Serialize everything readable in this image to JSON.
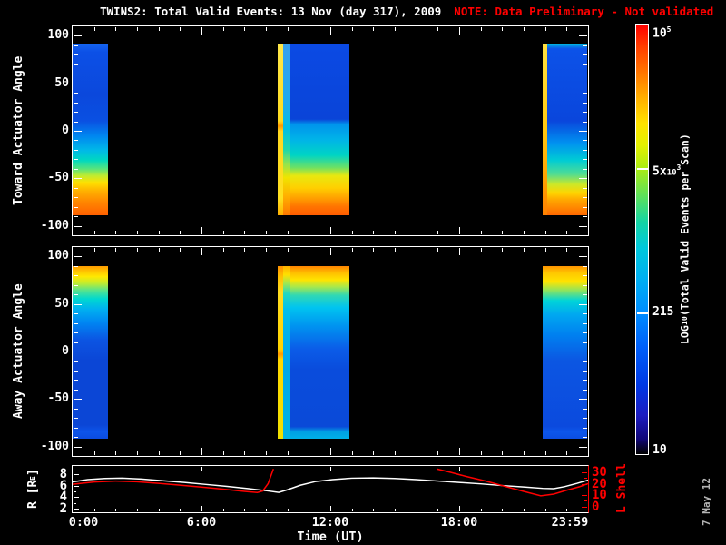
{
  "title": {
    "main": "TWINS2: Total Valid Events: 13 Nov (day 317), 2009",
    "note": "NOTE: Data Preliminary - Not validated"
  },
  "datestamp": "7 May 12",
  "colors": {
    "background": "#000000",
    "axis": "#ffffff",
    "warning_text": "#ff0000",
    "l_shell_axis": "#ff0000",
    "r_line": "#ffffff",
    "datestamp_text": "#b4b4b4"
  },
  "colorbar": {
    "label_parts": {
      "pre": "LOG",
      "sub": "10",
      "post": "(Total Valid Events per Scan)"
    },
    "ticks": [
      {
        "pre": "10",
        "sup": "5",
        "frac": 0.012,
        "dash": false
      },
      {
        "pre": "5x",
        "small": "10",
        "sup": "3",
        "frac": 0.334,
        "dash": true
      },
      {
        "pre": "215",
        "frac": 0.672,
        "dash": true
      },
      {
        "pre": "10",
        "frac": 0.994,
        "dash": false
      }
    ],
    "gradient": [
      [
        0,
        "#ff0000"
      ],
      [
        0.05,
        "#ff3c00"
      ],
      [
        0.11,
        "#ff7400"
      ],
      [
        0.17,
        "#ffae00"
      ],
      [
        0.23,
        "#ffe200"
      ],
      [
        0.28,
        "#e4f000"
      ],
      [
        0.335,
        "#aaec14"
      ],
      [
        0.4,
        "#5ce05c"
      ],
      [
        0.46,
        "#14d4a4"
      ],
      [
        0.52,
        "#00c8dc"
      ],
      [
        0.6,
        "#00acf4"
      ],
      [
        0.672,
        "#008cff"
      ],
      [
        0.75,
        "#0060fa"
      ],
      [
        0.84,
        "#0038e4"
      ],
      [
        0.91,
        "#1c1cc0"
      ],
      [
        0.965,
        "#100678"
      ],
      [
        0.988,
        "#060324"
      ],
      [
        1,
        "#000000"
      ]
    ]
  },
  "chart_data": [
    {
      "type": "heatmap",
      "id": "toward",
      "ylabel": "Toward Actuator Angle",
      "ylim": [
        -100,
        100
      ],
      "yticks": [
        100,
        50,
        0,
        -50,
        -100
      ],
      "xlim_hours": [
        0,
        24
      ],
      "blocks": [
        {
          "t0": 0.0,
          "t1": 1.65,
          "a0": 92,
          "a1": -89,
          "stops": [
            [
              0,
              "#1464f0"
            ],
            [
              0.05,
              "#0c50e6"
            ],
            [
              0.3,
              "#0b48dc"
            ],
            [
              0.45,
              "#0a50e2"
            ],
            [
              0.54,
              "#0088f0"
            ],
            [
              0.62,
              "#00b8e8"
            ],
            [
              0.68,
              "#00d8c0"
            ],
            [
              0.73,
              "#58e47c"
            ],
            [
              0.77,
              "#c0ec30"
            ],
            [
              0.81,
              "#ffe000"
            ],
            [
              0.86,
              "#ffb000"
            ],
            [
              0.92,
              "#ff8800"
            ],
            [
              1,
              "#ff6000"
            ]
          ]
        },
        {
          "t0": 9.55,
          "t1": 9.82,
          "a0": 92,
          "a1": -89,
          "stops": [
            [
              0,
              "#ffe84a"
            ],
            [
              0.45,
              "#ffdc20"
            ],
            [
              0.48,
              "#ff9800"
            ],
            [
              0.51,
              "#ffd820"
            ],
            [
              0.9,
              "#ffe020"
            ],
            [
              1,
              "#ffb000"
            ]
          ]
        },
        {
          "t0": 9.82,
          "t1": 10.12,
          "a0": 92,
          "a1": -89,
          "stops": [
            [
              0,
              "#38a0ee"
            ],
            [
              0.35,
              "#20aaee"
            ],
            [
              0.5,
              "#00c0e0"
            ],
            [
              0.62,
              "#20d8a8"
            ],
            [
              0.7,
              "#90e450"
            ],
            [
              0.78,
              "#f0e400"
            ],
            [
              0.88,
              "#ffb400"
            ],
            [
              1,
              "#ff7800"
            ]
          ]
        },
        {
          "t0": 10.12,
          "t1": 12.9,
          "a0": 92,
          "a1": -89,
          "stops": [
            [
              0,
              "#0b4ae4"
            ],
            [
              0.44,
              "#0a44d8"
            ],
            [
              0.47,
              "#0094ec"
            ],
            [
              0.56,
              "#00b4e8"
            ],
            [
              0.65,
              "#00d4c4"
            ],
            [
              0.72,
              "#68e068"
            ],
            [
              0.77,
              "#e8e810"
            ],
            [
              0.84,
              "#ffd000"
            ],
            [
              0.9,
              "#ffa000"
            ],
            [
              0.95,
              "#ff7400"
            ],
            [
              1,
              "#ff5c00"
            ]
          ]
        },
        {
          "t0": 21.9,
          "t1": 22.08,
          "a0": 92,
          "a1": -89,
          "stops": [
            [
              0,
              "#ffe040"
            ],
            [
              0.5,
              "#ffc810"
            ],
            [
              0.8,
              "#ffa000"
            ],
            [
              1,
              "#ff8000"
            ]
          ]
        },
        {
          "t0": 22.08,
          "t1": 23.96,
          "a0": 92,
          "a1": -89,
          "stops": [
            [
              0,
              "#00b4e0"
            ],
            [
              0.03,
              "#0c52e8"
            ],
            [
              0.45,
              "#0a46dc"
            ],
            [
              0.58,
              "#0092f0"
            ],
            [
              0.68,
              "#00ccd4"
            ],
            [
              0.76,
              "#50dc94"
            ],
            [
              0.82,
              "#cce828"
            ],
            [
              0.87,
              "#ffd400"
            ],
            [
              0.91,
              "#ffa800"
            ],
            [
              1,
              "#ff6800"
            ]
          ]
        }
      ]
    },
    {
      "type": "heatmap",
      "id": "away",
      "ylabel": "Away Actuator Angle",
      "ylim": [
        -100,
        100
      ],
      "yticks": [
        100,
        50,
        0,
        -50,
        -100
      ],
      "xlim_hours": [
        0,
        24
      ],
      "blocks": [
        {
          "t0": 0.0,
          "t1": 1.65,
          "a0": 90,
          "a1": -92,
          "stops": [
            [
              0,
              "#ff9c00"
            ],
            [
              0.03,
              "#ffc400"
            ],
            [
              0.06,
              "#ffe800"
            ],
            [
              0.1,
              "#c0ec30"
            ],
            [
              0.14,
              "#58e48c"
            ],
            [
              0.19,
              "#00d8d0"
            ],
            [
              0.25,
              "#00b0f0"
            ],
            [
              0.33,
              "#0084f2"
            ],
            [
              0.43,
              "#0c54e2"
            ],
            [
              0.55,
              "#0b46d6"
            ],
            [
              0.92,
              "#0b46d6"
            ],
            [
              0.96,
              "#0d54ea"
            ],
            [
              1,
              "#0b4ce0"
            ]
          ]
        },
        {
          "t0": 9.55,
          "t1": 9.82,
          "a0": 90,
          "a1": -92,
          "stops": [
            [
              0,
              "#ff9000"
            ],
            [
              0.06,
              "#ffc000"
            ],
            [
              0.15,
              "#ffdc20"
            ],
            [
              0.48,
              "#ffd400"
            ],
            [
              0.51,
              "#ff9800"
            ],
            [
              0.54,
              "#ffd800"
            ],
            [
              1,
              "#f0e000"
            ]
          ]
        },
        {
          "t0": 9.82,
          "t1": 10.12,
          "a0": 90,
          "a1": -92,
          "stops": [
            [
              0,
              "#ffb000"
            ],
            [
              0.05,
              "#ffe000"
            ],
            [
              0.1,
              "#a0e850"
            ],
            [
              0.16,
              "#20d8c0"
            ],
            [
              0.25,
              "#00c0ec"
            ],
            [
              0.4,
              "#00b0ea"
            ],
            [
              0.6,
              "#00a8e8"
            ],
            [
              1,
              "#00b4e4"
            ]
          ]
        },
        {
          "t0": 10.12,
          "t1": 12.9,
          "a0": 90,
          "a1": -92,
          "stops": [
            [
              0,
              "#ff8400"
            ],
            [
              0.04,
              "#ffc000"
            ],
            [
              0.08,
              "#ffe400"
            ],
            [
              0.12,
              "#a8e84c"
            ],
            [
              0.17,
              "#30d8b4"
            ],
            [
              0.24,
              "#00c4f0"
            ],
            [
              0.35,
              "#0092f0"
            ],
            [
              0.48,
              "#0b5ce8"
            ],
            [
              0.6,
              "#0a4cdc"
            ],
            [
              0.93,
              "#0a4ad8"
            ],
            [
              0.96,
              "#00a0e4"
            ],
            [
              1,
              "#00b0e6"
            ]
          ]
        },
        {
          "t0": 21.9,
          "t1": 23.96,
          "a0": 90,
          "a1": -92,
          "stops": [
            [
              0,
              "#ff9400"
            ],
            [
              0.04,
              "#ffc800"
            ],
            [
              0.09,
              "#ffe400"
            ],
            [
              0.14,
              "#90e45c"
            ],
            [
              0.2,
              "#00d4d8"
            ],
            [
              0.28,
              "#00a8f0"
            ],
            [
              0.4,
              "#0080f0"
            ],
            [
              0.55,
              "#0c56e2"
            ],
            [
              0.93,
              "#0b4ade"
            ],
            [
              0.96,
              "#0d56ea"
            ],
            [
              1,
              "#0b4ee2"
            ]
          ]
        }
      ]
    },
    {
      "type": "line",
      "id": "orbit",
      "xlabel": "Time (UT)",
      "xticks": [
        {
          "h": 0,
          "label": "0:00"
        },
        {
          "h": 6,
          "label": "6:00"
        },
        {
          "h": 12,
          "label": "12:00"
        },
        {
          "h": 18,
          "label": "18:00"
        },
        {
          "h": 23.983,
          "label": "23:59"
        }
      ],
      "left_axis": {
        "label_parts": {
          "pre": "R [R",
          "sub": "E",
          "post": "]"
        },
        "ticks": [
          8,
          6,
          4,
          2
        ],
        "range": [
          1.5,
          9.5
        ]
      },
      "right_axis": {
        "label": "L Shell",
        "ticks": [
          30,
          20,
          10,
          0
        ],
        "range": [
          0,
          30
        ],
        "color": "#ff0000"
      },
      "series": [
        {
          "name": "R",
          "color": "#ffffff",
          "points": [
            [
              0,
              6.7
            ],
            [
              0.7,
              7.1
            ],
            [
              1.5,
              7.3
            ],
            [
              2.3,
              7.35
            ],
            [
              3.2,
              7.2
            ],
            [
              4.2,
              6.9
            ],
            [
              5.2,
              6.6
            ],
            [
              6.2,
              6.25
            ],
            [
              7.2,
              5.9
            ],
            [
              8.2,
              5.5
            ],
            [
              9.0,
              5.15
            ],
            [
              9.6,
              4.85
            ],
            [
              10.0,
              5.3
            ],
            [
              10.6,
              6.1
            ],
            [
              11.3,
              6.75
            ],
            [
              12.1,
              7.1
            ],
            [
              13.0,
              7.35
            ],
            [
              14.0,
              7.4
            ],
            [
              15.0,
              7.3
            ],
            [
              16.0,
              7.1
            ],
            [
              17.0,
              6.85
            ],
            [
              18.0,
              6.6
            ],
            [
              19.0,
              6.35
            ],
            [
              20.0,
              6.05
            ],
            [
              21.0,
              5.8
            ],
            [
              21.9,
              5.55
            ],
            [
              22.4,
              5.5
            ],
            [
              22.9,
              5.85
            ],
            [
              23.5,
              6.45
            ],
            [
              24,
              7.0
            ]
          ]
        },
        {
          "name": "L Shell",
          "color": "#ff0000",
          "segments": [
            [
              [
                0,
                19.5
              ],
              [
                1,
                21.5
              ],
              [
                2,
                22.3
              ],
              [
                3,
                21.7
              ],
              [
                4,
                20.3
              ],
              [
                5,
                18.7
              ],
              [
                6,
                17.0
              ],
              [
                7,
                15.2
              ],
              [
                8,
                13.2
              ],
              [
                8.6,
                12.2
              ],
              [
                8.85,
                13.5
              ],
              [
                9.1,
                20.0
              ],
              [
                9.35,
                33.0
              ]
            ],
            [
              [
                16.95,
                33.0
              ],
              [
                17.6,
                30.0
              ],
              [
                18.3,
                26.5
              ],
              [
                19.2,
                22.5
              ],
              [
                20.1,
                17.8
              ],
              [
                21.0,
                13.2
              ],
              [
                21.8,
                9.3
              ],
              [
                22.4,
                10.8
              ],
              [
                23.0,
                14.2
              ],
              [
                23.6,
                17.3
              ],
              [
                24,
                20.0
              ]
            ]
          ]
        }
      ]
    },
    {
      "type": "colorbar",
      "scale": "log10",
      "value_min": 10,
      "value_max": 100000,
      "tick_values": [
        100000,
        5000,
        215,
        10
      ]
    }
  ]
}
